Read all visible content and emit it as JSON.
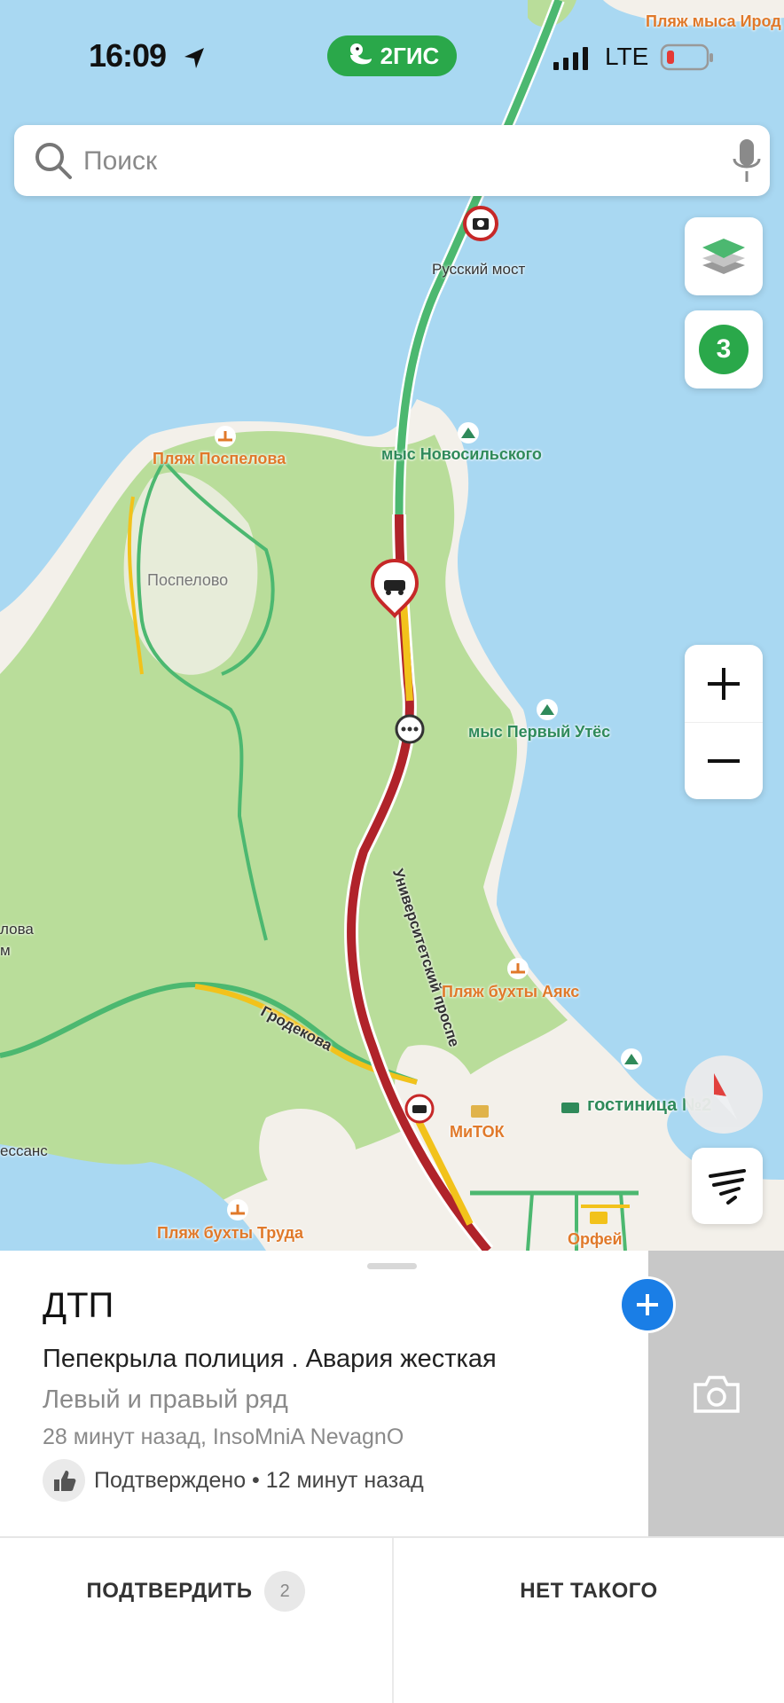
{
  "status_bar": {
    "time": "16:09",
    "app_badge": "2ГИС",
    "network": "LTE"
  },
  "search": {
    "placeholder": "Поиск"
  },
  "map": {
    "traffic_level": "3",
    "labels": {
      "beach_top": "Пляж мыса Ирод",
      "bridge": "Русский мост",
      "cape_novosil": "мыс Новосильского",
      "beach_pospelova": "Пляж Поспелова",
      "pospelovo": "Поспелово",
      "cape_first_cliff": "мыс Первый Утёс",
      "univ_prospect": "Университетский проспе",
      "grodekova": "Гродекова",
      "beach_ajax": "Пляж бухты Аякс",
      "hotel": "гостиница №2",
      "mitok": "МиТОК",
      "beach_truda": "Пляж бухты Труда",
      "orfey": "Орфей",
      "left_edge_1": "лова",
      "left_edge_2": "м",
      "left_edge_3": "ессанс"
    }
  },
  "incident": {
    "title": "ДТП",
    "description": "Пепекрыла полиция . Авария жесткая",
    "lanes": "Левый и правый ряд",
    "meta": "28 минут назад, InsoMniA NevagnO",
    "confirmed_text": "Подтверждено • 12 минут назад"
  },
  "actions": {
    "confirm_label": "ПОДТВЕРДИТЬ",
    "confirm_count": "2",
    "reject_label": "НЕТ ТАКОГО"
  },
  "colors": {
    "water": "#a9d8f2",
    "land": "#f3f0ea",
    "park": "#b9dd9a",
    "brand_green": "#2aa84a",
    "traffic_red": "#b0232a",
    "traffic_yellow": "#f2c21b",
    "traffic_green": "#4cb870",
    "accent_blue": "#1a7ee6"
  }
}
